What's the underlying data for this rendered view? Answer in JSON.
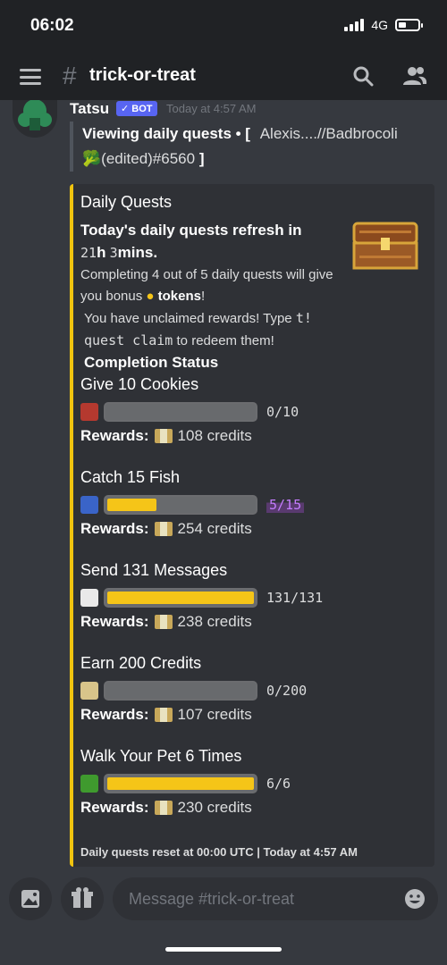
{
  "status_bar": {
    "time": "06:02",
    "network": "4G"
  },
  "header": {
    "hash": "#",
    "channel": "trick-or-treat",
    "icons": [
      "menu-icon",
      "search-icon",
      "members-icon"
    ]
  },
  "message": {
    "author": "Tatsu",
    "badge": "✓ BOT",
    "timestamp": "Today at 4:57 AM",
    "quote_bold": "Viewing daily quests • [",
    "quote_user": "Alexis....//Badbrocoli",
    "quote_line2": "🥦(edited)#6560",
    "quote_close": "]"
  },
  "embed": {
    "accent": "#f1c40f",
    "title": "Daily Quests",
    "refresh_prefix": "Today's daily quests refresh in",
    "refresh_hours": "21",
    "refresh_h": "h",
    "refresh_mins_num": "3",
    "refresh_mins": "mins.",
    "bonus_text": "Completing 4 out of 5 daily quests will give you bonus",
    "tokens_word": "tokens",
    "unclaimed_text": "You have unclaimed rewards! Type",
    "command": "t! quest claim",
    "redeem_text": "to redeem them!",
    "completion_title": "Completion Status",
    "rewards_label": "Rewards:",
    "quests": [
      {
        "name": "Give 10 Cookies",
        "progress": "0/10",
        "fraction": 0.0,
        "reward": "108 credits",
        "icon_color": "#b5392f"
      },
      {
        "name": "Catch 15 Fish",
        "progress": "5/15",
        "fraction": 0.333,
        "reward": "254 credits",
        "icon_color": "#3a64c8",
        "highlighted": true
      },
      {
        "name": "Send 131 Messages",
        "progress": "131/131",
        "fraction": 1.0,
        "reward": "238 credits",
        "icon_color": "#e9e9e9"
      },
      {
        "name": "Earn 200 Credits",
        "progress": "0/200",
        "fraction": 0.0,
        "reward": "107 credits",
        "icon_color": "#d8c48a"
      },
      {
        "name": "Walk Your Pet 6 Times",
        "progress": "6/6",
        "fraction": 1.0,
        "reward": "230 credits",
        "icon_color": "#3f9a2e"
      }
    ],
    "footer": "Daily quests reset at 00:00 UTC | Today at 4:57 AM"
  },
  "composer": {
    "placeholder": "Message #trick-or-treat"
  }
}
